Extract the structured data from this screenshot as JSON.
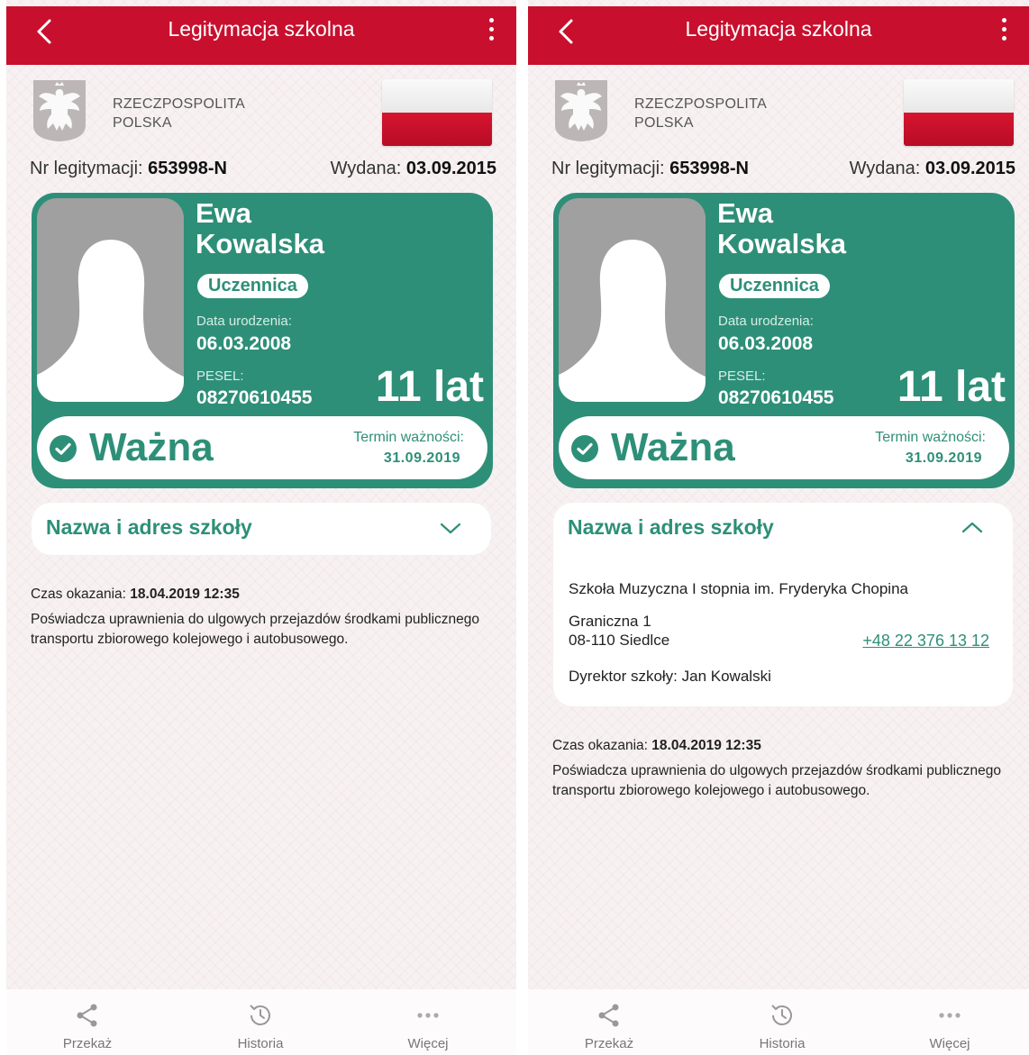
{
  "header": {
    "title": "Legitymacja szkolna"
  },
  "issuer": {
    "line1": "RZECZPOSPOLITA",
    "line2": "POLSKA"
  },
  "document": {
    "number_label": "Nr legitymacji:",
    "number": "653998-N",
    "issued_label": "Wydana:",
    "issued": "03.09.2015"
  },
  "person": {
    "first_name": "Ewa",
    "last_name": "Kowalska",
    "role": "Uczennica",
    "birth_label": "Data urodzenia:",
    "birth_date": "06.03.2008",
    "pesel_label": "PESEL:",
    "pesel": "08270610455",
    "age": "11 lat"
  },
  "status": {
    "text": "Ważna",
    "expiry_label": "Termin ważności:",
    "expiry": "31.09.2019"
  },
  "school": {
    "section_title": "Nazwa i adres szkoły",
    "name": "Szkoła Muzyczna I stopnia im. Fryderyka Chopina",
    "street": "Graniczna 1",
    "city": "08-110 Siedlce",
    "phone": "+48 22 376 13 12",
    "director": "Dyrektor szkoły: Jan Kowalski"
  },
  "presentation": {
    "time_label": "Czas okazania:",
    "time": "18.04.2019 12:35",
    "note": "Poświadcza uprawnienia do ulgowych przejazdów środkami publicznego transportu zbiorowego kolejowego i autobusowego."
  },
  "tabs": {
    "share": "Przekaż",
    "history": "Historia",
    "more": "Więcej"
  },
  "colors": {
    "header_red": "#c8102e",
    "card_green": "#2e8f78",
    "flag_red": "#d7142f"
  }
}
